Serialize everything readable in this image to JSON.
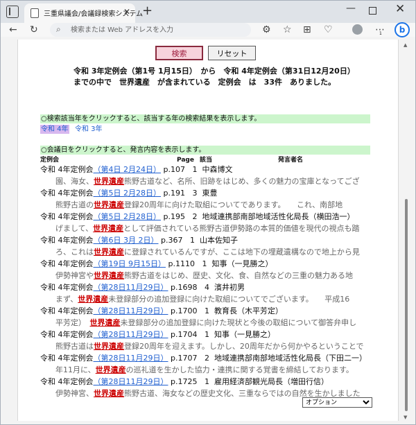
{
  "browser": {
    "tab_title": "三重県議会/会議録検索システム",
    "tab_close": "✕",
    "new_tab": "+",
    "address_placeholder": "検索または Web アドレスを入力",
    "extension_badge": "1",
    "bing": "b",
    "icons": [
      "tab-actions-icon",
      "back-icon",
      "refresh-icon",
      "search-icon",
      "extensions-icon",
      "favorites-icon",
      "collections-icon",
      "heart-icon",
      "profile-icon",
      "more-icon",
      "bing-icon"
    ]
  },
  "form": {
    "search_label": "検索",
    "reset_label": "リセット"
  },
  "summary": "令和 3年定例会（第1号 1月15日）　から　令和 4年定例会（第31日12月20日）までの中で　世界遺産　が含まれている　定例会　は　33件　ありました。",
  "year_section": {
    "instruction": "○検索該当年をクリックすると、該当する年の検索結果を表示します。",
    "years": [
      "令和 4年",
      "令和 3年"
    ]
  },
  "meeting_section": {
    "instruction": "○会議日をクリックすると、発言内容を表示します。",
    "columns": {
      "session": "定例会",
      "page": "Page",
      "item": "該当",
      "speaker": "発言者名"
    }
  },
  "entries": [
    {
      "session": "令和 4年定例会",
      "date": "（第4日 2月24日）",
      "page": "p.107",
      "num": "1",
      "speaker": "中森博文",
      "pre": "園、海女、",
      "kw": "世界遺産",
      "post": "熊野古道など、名所、旧跡をはじめ、多くの魅力の宝庫となってござ"
    },
    {
      "session": "令和 4年定例会",
      "date": "（第5日 2月28日）",
      "page": "p.191",
      "num": "3",
      "speaker": "東豊",
      "pre": "熊野古道の",
      "kw": "世界遺産",
      "post": "登録20周年に向けた取組についてであります。　　これ、南部地"
    },
    {
      "session": "令和 4年定例会",
      "date": "（第5日 2月28日）",
      "page": "p.195",
      "num": "2",
      "speaker": "地域連携部南部地域活性化局長（横田浩一）",
      "pre": "げまして、",
      "kw": "世界遺産",
      "post": "として評価されている熊野古道伊勢路の本質的価値を現代の視点も踏"
    },
    {
      "session": "令和 4年定例会",
      "date": "（第6日 3月 2日）",
      "page": "p.367",
      "num": "1",
      "speaker": "山本佐知子",
      "pre": "ろ、これは",
      "kw": "世界遺産",
      "post": "に登録されているんですが、ここは地下の埋蔵遺構なので地上から見"
    },
    {
      "session": "令和 4年定例会",
      "date": "（第19日 9月15日）",
      "page": "p.1110",
      "num": "1",
      "speaker": "知事（一見勝之）",
      "pre": "伊勢神宮や",
      "kw": "世界遺産",
      "post": "熊野古道をはじめ、歴史、文化、食、自然などの三重の魅力ある地"
    },
    {
      "session": "令和 4年定例会",
      "date": "（第28日11月29日）",
      "page": "p.1698",
      "num": "4",
      "speaker": "濱井初男",
      "pre": "まず、",
      "kw": "世界遺産",
      "post": "未登録部分の追加登録に向けた取組についてでございます。　　平成16"
    },
    {
      "session": "令和 4年定例会",
      "date": "（第28日11月29日）",
      "page": "p.1700",
      "num": "1",
      "speaker": "教育長（木平芳定）",
      "pre": "平芳定）　",
      "kw": "世界遺産",
      "post": "未登録部分の追加登録に向けた現状と今後の取組について御答弁申し"
    },
    {
      "session": "令和 4年定例会",
      "date": "（第28日11月29日）",
      "page": "p.1704",
      "num": "1",
      "speaker": "知事（一見勝之）",
      "pre": "熊野古道は",
      "kw": "世界遺産",
      "post": "登録20周年を迎えます。しかし、20周年だから何かやるということで"
    },
    {
      "session": "令和 4年定例会",
      "date": "（第28日11月29日）",
      "page": "p.1707",
      "num": "2",
      "speaker": "地域連携部南部地域活性化局長（下田二一）",
      "pre": "年11月に、",
      "kw": "世界遺産",
      "post": "の巡礼道を生かした協力・連携に関する覚書を締結しております。"
    },
    {
      "session": "令和 4年定例会",
      "date": "（第28日11月29日）",
      "page": "p.1725",
      "num": "1",
      "speaker": "雇用経済部観光局長（増田行信）",
      "pre": "伊勢神宮、",
      "kw": "世界遺産",
      "post": "熊野古道、海女などの歴史文化、三重ならではの自然を生かしました"
    }
  ],
  "options_select": {
    "selected": "オプション"
  }
}
